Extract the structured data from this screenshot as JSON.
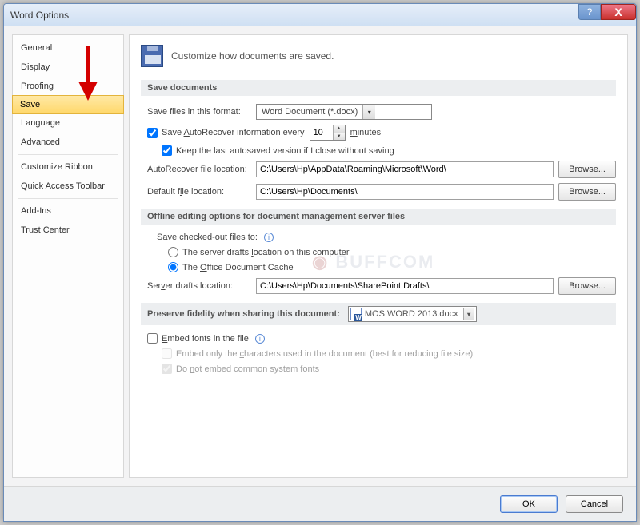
{
  "window": {
    "title": "Word Options"
  },
  "winbtns": {
    "help": "?",
    "close": "X"
  },
  "sidebar": {
    "items": [
      {
        "label": "General"
      },
      {
        "label": "Display"
      },
      {
        "label": "Proofing"
      },
      {
        "label": "Save"
      },
      {
        "label": "Language"
      },
      {
        "label": "Advanced"
      },
      {
        "label": "Customize Ribbon"
      },
      {
        "label": "Quick Access Toolbar"
      },
      {
        "label": "Add-Ins"
      },
      {
        "label": "Trust Center"
      }
    ],
    "selected": "Save"
  },
  "hdr": {
    "subtitle": "Customize how documents are saved."
  },
  "sec": {
    "save_documents": "Save documents",
    "offline": "Offline editing options for document management server files",
    "preserve": "Preserve fidelity when sharing this document:"
  },
  "save": {
    "formatLabel": "Save files in this format:",
    "formatValue": "Word Document (*.docx)",
    "autorecoverLabel": "Save AutoRecover information every",
    "autorecoverChecked": true,
    "autorecoverMinutes": "10",
    "minutesWord": "minutes",
    "keepLastLabel": "Keep the last autosaved version if I close without saving",
    "keepLastChecked": true,
    "autoRecoverLocLabel": "AutoRecover file location:",
    "autoRecoverLoc": "C:\\Users\\Hp\\AppData\\Roaming\\Microsoft\\Word\\",
    "defaultLocLabel": "Default file location:",
    "defaultLoc": "C:\\Users\\Hp\\Documents\\",
    "browse": "Browse..."
  },
  "offline": {
    "saveCheckedOutLabel": "Save checked-out files to:",
    "radioServer": "The server drafts location on this computer",
    "radioCache": "The Office Document Cache",
    "selected": "cache",
    "serverDraftsLabel": "Server drafts location:",
    "serverDraftsPath": "C:\\Users\\Hp\\Documents\\SharePoint Drafts\\",
    "browse": "Browse..."
  },
  "preserve": {
    "docname": "MOS WORD 2013.docx",
    "embedFonts": "Embed fonts in the file",
    "embedOnlyUsed": "Embed only the characters used in the document (best for reducing file size)",
    "noCommon": "Do not embed common system fonts"
  },
  "footer": {
    "ok": "OK",
    "cancel": "Cancel"
  }
}
